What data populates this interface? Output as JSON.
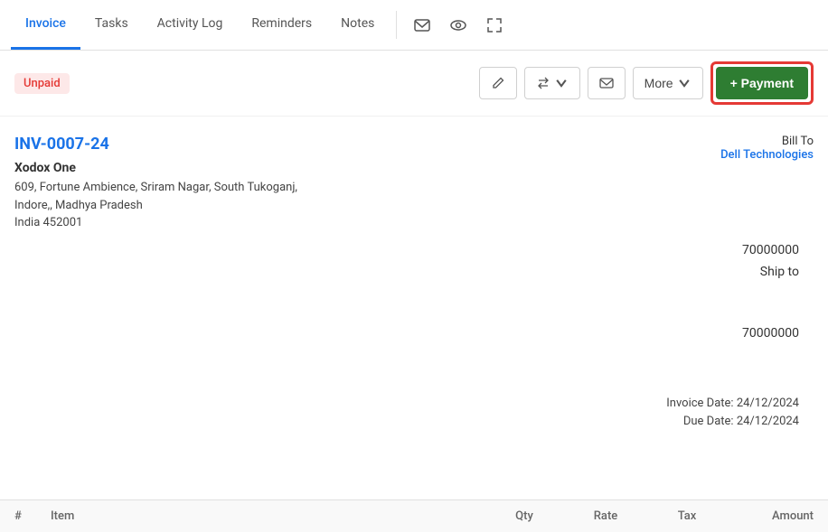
{
  "tabs": [
    {
      "id": "invoice",
      "label": "Invoice",
      "active": true
    },
    {
      "id": "tasks",
      "label": "Tasks",
      "active": false
    },
    {
      "id": "activity-log",
      "label": "Activity Log",
      "active": false
    },
    {
      "id": "reminders",
      "label": "Reminders",
      "active": false
    },
    {
      "id": "notes",
      "label": "Notes",
      "active": false
    }
  ],
  "toolbar": {
    "status": "Unpaid",
    "more_label": "More",
    "payment_label": "+ Payment"
  },
  "invoice": {
    "id": "INV-0007-24",
    "company": "Xodox One",
    "address1": "609, Fortune Ambience, Sriram Nagar, South Tukoganj,",
    "address2": "Indore,, Madhya Pradesh",
    "address3": "India 452001",
    "bill_to_label": "Bill To",
    "bill_to_name": "Dell Technologies",
    "phone": "70000000",
    "ship_to_label": "Ship to",
    "phone2": "70000000",
    "invoice_date_label": "Invoice Date:",
    "invoice_date": "24/12/2024",
    "due_date_label": "Due Date:",
    "due_date": "24/12/2024"
  },
  "table": {
    "cols": [
      "#",
      "Item",
      "Qty",
      "Rate",
      "Tax",
      "Amount"
    ]
  }
}
